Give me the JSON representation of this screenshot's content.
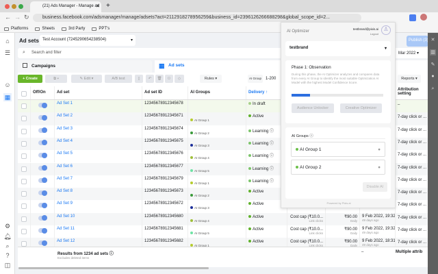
{
  "browser": {
    "tab_title": "(21) Ads Manager - Manage ad",
    "url": "business.facebook.com/adsmanager/manage/adsets?act=2112918278956259&business_id=2396126266688298&global_scope_id=2...",
    "bookmarks": [
      "Platforms",
      "Sheets",
      "3rd Party",
      "PPT's"
    ]
  },
  "header": {
    "title": "Ad sets",
    "account": "Test Account (7245290654238504)",
    "search_placeholder": "Search and filter",
    "date": "Mar 2022",
    "publish": "Publish (3)"
  },
  "tabs": {
    "campaigns": "Campaigns",
    "adsets": "Ad sets"
  },
  "toolbar": {
    "create": "+ Create",
    "edit": "Edit",
    "ab_test": "A/B test",
    "rules": "Rules",
    "ai_group": "AI Group",
    "range": "1-200",
    "reports": "Reports"
  },
  "columns": {
    "offon": "Off/On",
    "adset": "Ad set",
    "id": "Ad set ID",
    "ai_groups": "AI Groups",
    "delivery": "Delivery ↑",
    "attribution": "Attribution setting"
  },
  "rows": [
    {
      "name": "Ad Set 1",
      "id": "12345678912345678",
      "group": "",
      "gcolor": "",
      "delivery": "In draft",
      "dcolor": "#a6d08a",
      "attr": "–"
    },
    {
      "name": "Ad Set 2",
      "id": "12345678912345671",
      "group": "AI Group 1",
      "gcolor": "#b5cc2e",
      "delivery": "Active",
      "dcolor": "#5fb12b",
      "attr": "7-day click or ..."
    },
    {
      "name": "Ad Set 3",
      "id": "12345678912345674",
      "group": "AI Group 2",
      "gcolor": "#3a9a3a",
      "delivery": "Learning ⓘ",
      "dcolor": "#7cc46a",
      "attr": "7-day click or ..."
    },
    {
      "name": "Ad Set 4",
      "id": "12345678912345675",
      "group": "AI Group 3",
      "gcolor": "#1d2f9a",
      "delivery": "Learning ⓘ",
      "dcolor": "#7cc46a",
      "attr": "7-day click or ..."
    },
    {
      "name": "Ad Set 5",
      "id": "12345678912345676",
      "group": "AI Group 4",
      "gcolor": "#9fbf3a",
      "delivery": "Learning ⓘ",
      "dcolor": "#7cc46a",
      "attr": "7-day click or ..."
    },
    {
      "name": "Ad Set 6",
      "id": "12345678912345677",
      "group": "AI Group 5",
      "gcolor": "#6fe3a5",
      "delivery": "Learning ⓘ",
      "dcolor": "#7cc46a",
      "attr": "7-day click or ..."
    },
    {
      "name": "Ad Set 7",
      "id": "12345678912345679",
      "group": "AI Group 1",
      "gcolor": "#b5cc2e",
      "delivery": "Learning ⓘ",
      "dcolor": "#7cc46a",
      "attr": "7-day click or ..."
    },
    {
      "name": "Ad Set 8",
      "id": "12345678912345673",
      "group": "AI Group 2",
      "gcolor": "#3a9a3a",
      "delivery": "Active",
      "dcolor": "#5fb12b",
      "attr": "7-day click or ..."
    },
    {
      "name": "Ad Set 9",
      "id": "12345678912345672",
      "group": "AI Group 3",
      "gcolor": "#1d2f9a",
      "delivery": "Active",
      "dcolor": "#5fb12b",
      "attr": "7-day click or ...",
      "bid_sub": "Link clicks",
      "budget_sub": "Daily",
      "edit_sub": "49 days ago"
    },
    {
      "name": "Ad Set 10",
      "id": "12345678912345680",
      "group": "AI Group 4",
      "gcolor": "#9fbf3a",
      "delivery": "Active",
      "dcolor": "#5fb12b",
      "attr": "7-day click or ...",
      "bid": "Cost cap (₹10.0...",
      "bid_sub": "Link clicks",
      "budget": "₹90.00",
      "budget_sub": "Daily",
      "edit": "9 Feb 2022, 19:32",
      "edit_sub": "49 days ago"
    },
    {
      "name": "Ad Set 11",
      "id": "12345678912345681",
      "group": "AI Group 5",
      "gcolor": "#6fe3a5",
      "delivery": "Active",
      "dcolor": "#5fb12b",
      "attr": "7-day click or ...",
      "bid": "Cost cap (₹10.0...",
      "bid_sub": "Link clicks",
      "budget": "₹90.00",
      "budget_sub": "Daily",
      "edit": "9 Feb 2022, 19:32",
      "edit_sub": "49 days ago"
    },
    {
      "name": "Ad Set 12",
      "id": "12345678912345682",
      "group": "AI Group 1",
      "gcolor": "#b5cc2e",
      "delivery": "Active",
      "dcolor": "#5fb12b",
      "attr": "7-day click or ...",
      "bid": "Cost cap (₹10.0...",
      "bid_sub": "Link clicks",
      "budget": "₹90.00",
      "budget_sub": "Daily",
      "edit": "9 Feb 2022, 18:31",
      "edit_sub": "49 days ago"
    }
  ],
  "footer": {
    "results": "Results from 1234 ad sets ⓘ",
    "excludes": "Excludes deleted items",
    "edit_total": "–",
    "attr_total": "Multiple attrib"
  },
  "optimizer": {
    "title": "AI Optimizer",
    "email": "testbrand@pixis.ai",
    "logout": "Logout",
    "brand": "testbrand",
    "phase_title": "Phase 1: Observation",
    "phase_desc": "During this phase, the AI Optimizer analyzes and compares data from every AI Group to identify the most suitable Optimization AI Model with the highest Model Confidence Score.",
    "progress": 0.2,
    "audience_btn": "Audience Unlocker",
    "creative_btn": "Creative Optimizer",
    "groups_title": "AI Groups ⓘ",
    "groups": [
      {
        "name": "AI Group 1",
        "color": "#6cc04a"
      },
      {
        "name": "AI Group 2",
        "color": "#6cc04a"
      }
    ],
    "disable": "Disable AI",
    "powered": "Powered by Pixis.ai"
  }
}
